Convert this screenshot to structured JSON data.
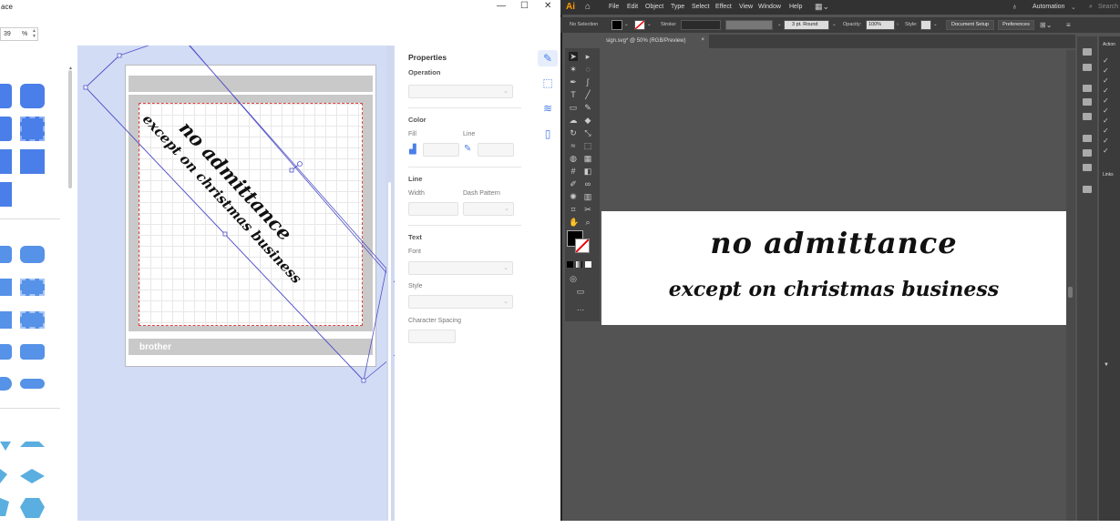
{
  "left_app": {
    "title_fragment": "ace",
    "window_buttons": {
      "minimize": "—",
      "maximize": "☐",
      "close": "✕"
    },
    "zoom": {
      "value": "39",
      "unit": "%"
    },
    "properties": {
      "title": "Properties",
      "operation_label": "Operation",
      "color_section": "Color",
      "fill_label": "Fill",
      "line_label": "Line",
      "line_section": "Line",
      "width_label": "Width",
      "dash_label": "Dash Pattern",
      "text_section": "Text",
      "font_label": "Font",
      "style_label": "Style",
      "char_spacing_label": "Character Spacing"
    },
    "mat_brand": "brother",
    "design_text": {
      "line1": "no admittance",
      "line2": "except on christmas business"
    },
    "accent_color": "#4a7ee8"
  },
  "right_app": {
    "logo": "Ai",
    "menu": [
      "File",
      "Edit",
      "Object",
      "Type",
      "Select",
      "Effect",
      "View",
      "Window",
      "Help"
    ],
    "workspace": "Automation",
    "search_placeholder": "Search",
    "control_bar": {
      "selection": "No Selection",
      "stroke_label": "Stroke:",
      "brush": "3 pt. Round",
      "opacity_label": "Opacity:",
      "opacity_value": "100%",
      "style_label": "Style:",
      "document_setup": "Document Setup",
      "preferences": "Preferences"
    },
    "document_tab": "sign.svg* @ 50% (RGB/Preview)",
    "close_tab": "×",
    "artboard_text": {
      "line1": "no admittance",
      "line2": "except on christmas business"
    },
    "right_panel": {
      "actions_label": "Action",
      "links_label": "Links"
    }
  }
}
